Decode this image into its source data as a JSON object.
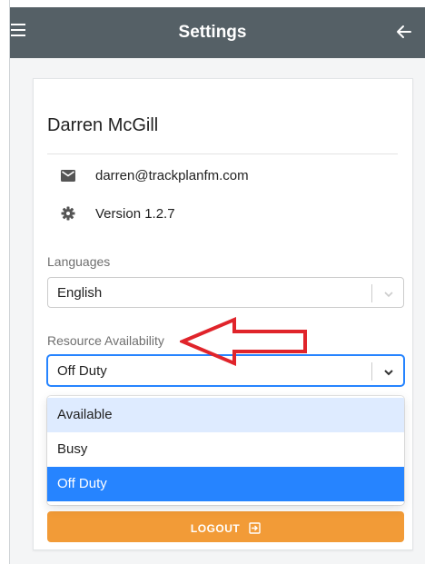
{
  "appbar": {
    "title": "Settings"
  },
  "profile": {
    "name": "Darren McGill",
    "email": "darren@trackplanfm.com",
    "version": "Version 1.2.7"
  },
  "languages": {
    "label": "Languages",
    "value": "English"
  },
  "availability": {
    "label": "Resource Availability",
    "value": "Off Duty",
    "options": [
      "Available",
      "Busy",
      "Off Duty"
    ]
  },
  "logout": {
    "label": "LOGOUT"
  },
  "colors": {
    "appbar": "#556066",
    "logout": "#f29b37",
    "focus": "#2684ff",
    "option_hover": "#deebff",
    "annotation": "#e0242b"
  },
  "icons": [
    "menu-icon",
    "arrow-left-icon",
    "email-icon",
    "gear-icon",
    "chevron-down-icon",
    "logout-icon"
  ]
}
